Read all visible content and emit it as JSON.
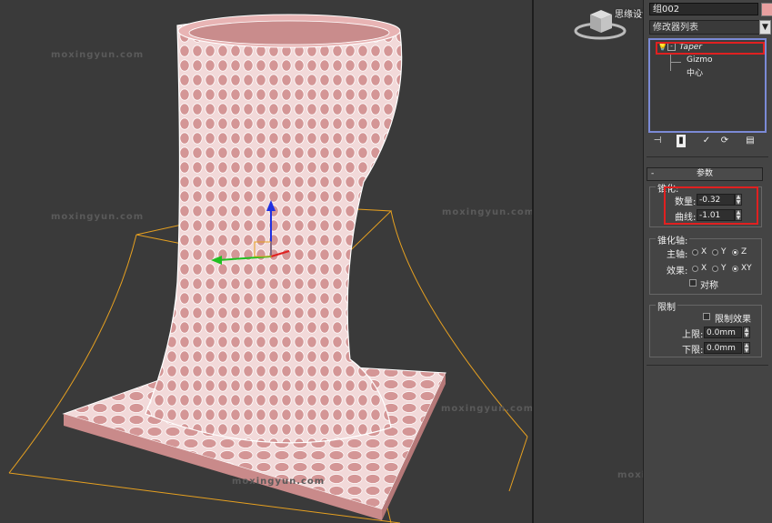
{
  "watermarks": {
    "site_text": "moxingyun.com",
    "top_right_text": "思缘设计论坛 www.MISSYUAN.COM"
  },
  "panel": {
    "object_name": "组002",
    "object_color": "#e8a0a0",
    "modifier_list_label": "修改器列表",
    "stack": {
      "items": [
        {
          "label": "Taper",
          "level": 0
        },
        {
          "label": "Gizmo",
          "level": 1
        },
        {
          "label": "中心",
          "level": 1
        }
      ]
    },
    "toolbar_icons": [
      "pin-stack-icon",
      "show-end-result-icon",
      "make-unique-icon",
      "remove-modifier-icon",
      "configure-modifier-sets-icon"
    ],
    "rollout_title": "参数",
    "taper_group": {
      "title": "锥化:",
      "amount_label": "数量:",
      "amount_value": "-0.32",
      "curve_label": "曲线:",
      "curve_value": "-1.01"
    },
    "axis_group": {
      "title": "锥化轴:",
      "primary_label": "主轴:",
      "primary_options": [
        "X",
        "Y",
        "Z"
      ],
      "primary_selected": "Z",
      "effect_label": "效果:",
      "effect_options": [
        "X",
        "Y",
        "XY"
      ],
      "effect_selected": "XY",
      "symmetry_label": "对称"
    },
    "limit_group": {
      "title": "限制",
      "limit_effect_label": "限制效果",
      "upper_label": "上限:",
      "upper_value": "0.0mm",
      "lower_label": "下限:",
      "lower_value": "0.0mm"
    },
    "highlight_color": "#e02020"
  },
  "viewport": {
    "mesh_color": "#e6a9a9",
    "gizmo_color": "#e6a020",
    "axis_colors": {
      "x": "#e02020",
      "y": "#20c020",
      "z": "#2030e0"
    }
  }
}
